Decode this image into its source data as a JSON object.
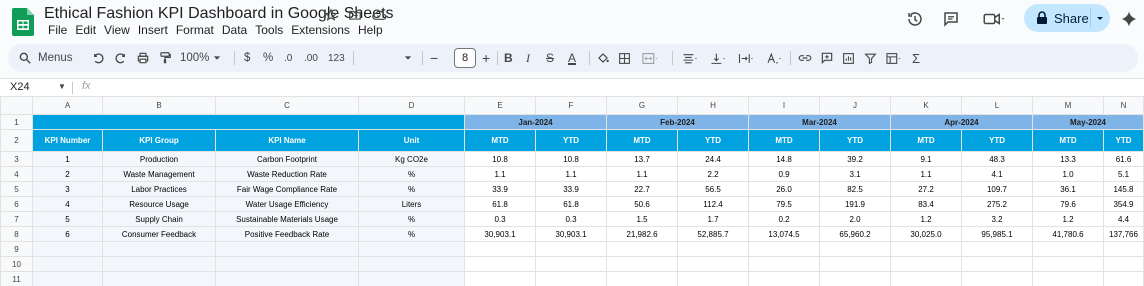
{
  "app": {
    "title": "Ethical Fashion KPI Dashboard in Google Sheets",
    "menu": [
      "File",
      "Edit",
      "View",
      "Insert",
      "Format",
      "Data",
      "Tools",
      "Extensions",
      "Help"
    ],
    "share_label": "Share",
    "brand_color": "#0f9d58",
    "share_bg": "#c2e7ff"
  },
  "toolbar": {
    "menus_label": "Menus",
    "zoom": "100%",
    "currency": "$",
    "percent": "%",
    "dec_minus": ".0",
    "dec_plus": ".00",
    "number_format": "123",
    "font_size": "8"
  },
  "formula_bar": {
    "cell_ref": "X24",
    "fx": "fx",
    "content": ""
  },
  "grid": {
    "columns": [
      "A",
      "B",
      "C",
      "D",
      "E",
      "F",
      "G",
      "H",
      "I",
      "J",
      "K",
      "L",
      "M",
      "N"
    ],
    "row_numbers": [
      "1",
      "2",
      "3",
      "4",
      "5",
      "6",
      "7",
      "8",
      "9",
      "10",
      "11"
    ],
    "months": [
      "Jan-2024",
      "Feb-2024",
      "Mar-2024",
      "Apr-2024",
      "May-2024"
    ],
    "headers": {
      "kpi_number": "KPI Number",
      "kpi_group": "KPI Group",
      "kpi_name": "KPI Name",
      "unit": "Unit",
      "mtd": "MTD",
      "ytd": "YTD"
    },
    "rows": [
      {
        "num": "1",
        "group": "Production",
        "name": "Carbon Footprint",
        "unit": "Kg CO2e",
        "vals": [
          "10.8",
          "10.8",
          "13.7",
          "24.4",
          "14.8",
          "39.2",
          "9.1",
          "48.3",
          "13.3",
          "61.6"
        ]
      },
      {
        "num": "2",
        "group": "Waste Management",
        "name": "Waste Reduction Rate",
        "unit": "%",
        "vals": [
          "1.1",
          "1.1",
          "1.1",
          "2.2",
          "0.9",
          "3.1",
          "1.1",
          "4.1",
          "1.0",
          "5.1"
        ]
      },
      {
        "num": "3",
        "group": "Labor Practices",
        "name": "Fair Wage Compliance Rate",
        "unit": "%",
        "vals": [
          "33.9",
          "33.9",
          "22.7",
          "56.5",
          "26.0",
          "82.5",
          "27.2",
          "109.7",
          "36.1",
          "145.8"
        ]
      },
      {
        "num": "4",
        "group": "Resource Usage",
        "name": "Water Usage Efficiency",
        "unit": "Liters",
        "vals": [
          "61.8",
          "61.8",
          "50.6",
          "112.4",
          "79.5",
          "191.9",
          "83.4",
          "275.2",
          "79.6",
          "354.9"
        ]
      },
      {
        "num": "5",
        "group": "Supply Chain",
        "name": "Sustainable Materials Usage",
        "unit": "%",
        "vals": [
          "0.3",
          "0.3",
          "1.5",
          "1.7",
          "0.2",
          "2.0",
          "1.2",
          "3.2",
          "1.2",
          "4.4"
        ]
      },
      {
        "num": "6",
        "group": "Consumer Feedback",
        "name": "Positive Feedback Rate",
        "unit": "%",
        "vals": [
          "30,903.1",
          "30,903.1",
          "21,982.6",
          "52,885.7",
          "13,074.5",
          "65,960.2",
          "30,025.0",
          "95,985.1",
          "41,780.6",
          "137,766"
        ]
      }
    ],
    "header_blue": "#00a3e0",
    "month_band": "#7fb4e8"
  }
}
